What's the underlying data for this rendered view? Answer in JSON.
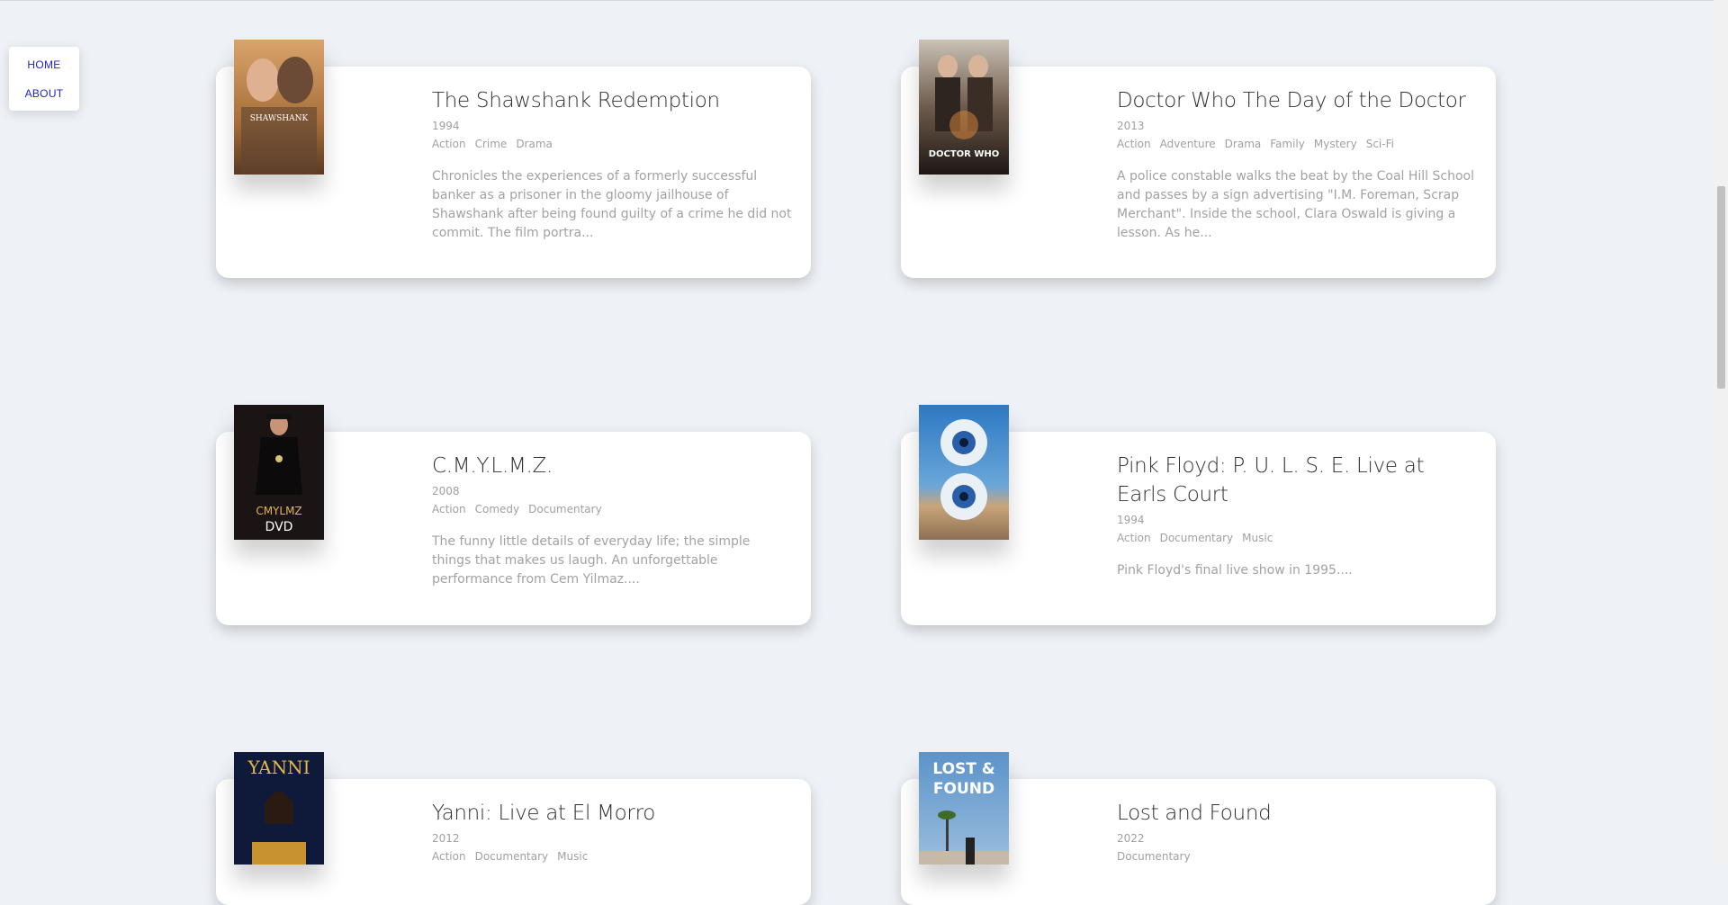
{
  "nav": {
    "home_label": "HOME",
    "about_label": "ABOUT"
  },
  "movies": [
    {
      "title": "The Shawshank Redemption",
      "year": "1994",
      "genres": [
        "Action",
        "Crime",
        "Drama"
      ],
      "description": "Chronicles the experiences of a formerly successful banker as a prisoner in the gloomy jailhouse of Shawshank after being found guilty of a crime he did not commit. The film portra...",
      "poster_text": "SHAWSHANK"
    },
    {
      "title": "Doctor Who The Day of the Doctor",
      "year": "2013",
      "genres": [
        "Action",
        "Adventure",
        "Drama",
        "Family",
        "Mystery",
        "Sci-Fi"
      ],
      "description": "A police constable walks the beat by the Coal Hill School and passes by a sign advertising \"I.M. Foreman, Scrap Merchant\". Inside the school, Clara Oswald is giving a lesson. As he...",
      "poster_text": "DOCTOR WHO"
    },
    {
      "title": "C.M.Y.L.M.Z.",
      "year": "2008",
      "genres": [
        "Action",
        "Comedy",
        "Documentary"
      ],
      "description": "The funny little details of everyday life; the simple things that makes us laugh. An unforgettable performance from Cem Yilmaz....",
      "poster_text": "CMYLMZ",
      "poster_text2": "DVD"
    },
    {
      "title": "Pink Floyd: P. U. L. S. E. Live at Earls Court",
      "year": "1994",
      "genres": [
        "Action",
        "Documentary",
        "Music"
      ],
      "description": "Pink Floyd's final live show in 1995....",
      "poster_text": ""
    },
    {
      "title": "Yanni: Live at El Morro",
      "year": "2012",
      "genres": [
        "Action",
        "Documentary",
        "Music"
      ],
      "description": "",
      "poster_text": "YANNI"
    },
    {
      "title": "Lost and Found",
      "year": "2022",
      "genres": [
        "Documentary"
      ],
      "description": "",
      "poster_text": "LOST &",
      "poster_text2": "FOUND"
    }
  ]
}
